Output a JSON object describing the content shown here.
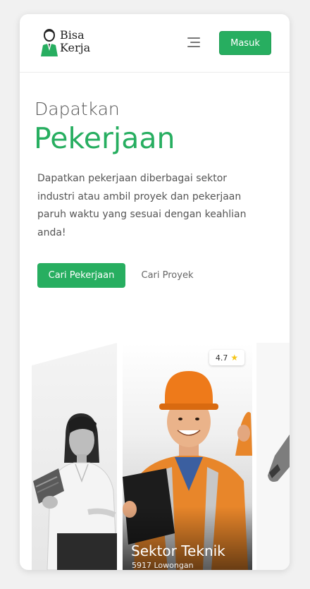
{
  "brand": {
    "name_line1": "Bisa",
    "name_line2": "Kerja"
  },
  "header": {
    "menu_icon": "hamburger-icon",
    "login_label": "Masuk"
  },
  "hero": {
    "pre_title": "Dapatkan",
    "title": "Pekerjaan",
    "description": "Dapatkan pekerjaan diberbagai sektor industri atau ambil proyek dan pekerjaan paruh waktu yang sesuai dengan keahlian anda!",
    "primary_cta": "Cari Pekerjaan",
    "secondary_cta": "Cari Proyek"
  },
  "featured_card": {
    "rating": "4.7",
    "rating_icon": "star-icon",
    "title": "Sektor Teknik",
    "subtitle": "5917 Lowongan"
  },
  "colors": {
    "accent": "#27ae60",
    "text": "#555555"
  }
}
